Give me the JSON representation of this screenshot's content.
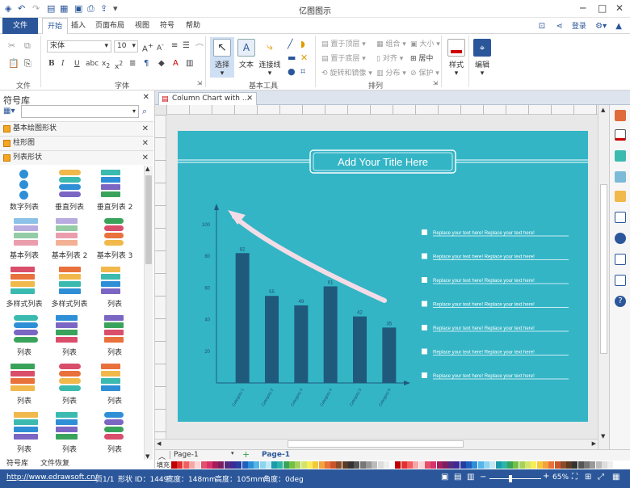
{
  "app": {
    "title": "亿图图示"
  },
  "menu": {
    "file": "文件",
    "tabs": [
      "开始",
      "插入",
      "页面布局",
      "视图",
      "符号",
      "帮助"
    ],
    "login": "登录"
  },
  "ribbon": {
    "groups": {
      "file": "文件",
      "font": "字体",
      "basic_tools": "基本工具",
      "arrange": "排列"
    },
    "font_name": "宋体",
    "font_size": "10",
    "tools": {
      "select": "选择",
      "text": "文本",
      "connector": "连接线"
    },
    "arrange": {
      "bring_front": "置于顶层",
      "send_back": "置于底层",
      "rotate_mirror": "旋转和镜像",
      "group": "组合",
      "align": "对齐",
      "distribute": "分布",
      "size": "大小",
      "center": "居中",
      "protect": "保护"
    },
    "style": "样式",
    "edit": "编辑"
  },
  "library": {
    "title": "符号库",
    "categories": [
      "基本绘图形状",
      "柱形图",
      "列表形状"
    ],
    "shapes": [
      {
        "label": "数字列表",
        "icon": "number-list-icon"
      },
      {
        "label": "垂直列表",
        "icon": "vertical-list-icon"
      },
      {
        "label": "垂直列表 2",
        "icon": "vertical-list-2-icon"
      },
      {
        "label": "基本列表",
        "icon": "basic-list-icon"
      },
      {
        "label": "基本列表 2",
        "icon": "basic-list-2-icon"
      },
      {
        "label": "基本列表 3",
        "icon": "basic-list-3-icon"
      },
      {
        "label": "多样式列表",
        "icon": "multi-style-list-icon"
      },
      {
        "label": "多样式列表",
        "icon": "multi-style-list-2-icon"
      },
      {
        "label": "列表",
        "icon": "list-icon"
      },
      {
        "label": "列表",
        "icon": "list-icon"
      },
      {
        "label": "列表",
        "icon": "list-icon"
      },
      {
        "label": "列表",
        "icon": "list-icon"
      },
      {
        "label": "列表",
        "icon": "list-icon"
      },
      {
        "label": "列表",
        "icon": "list-icon"
      },
      {
        "label": "列表",
        "icon": "list-icon"
      },
      {
        "label": "列表",
        "icon": "list-icon"
      },
      {
        "label": "列表",
        "icon": "list-icon"
      },
      {
        "label": "列表",
        "icon": "list-icon"
      }
    ],
    "bottom_tabs": [
      "符号库",
      "文件恢复"
    ]
  },
  "document": {
    "tab": "Column Chart with ...",
    "page_tab": "Page-1",
    "page_tab_active": "Page-1",
    "palette_label": "填充"
  },
  "colors": {
    "accent": "#2b579a",
    "page_bg": "#33b5c6",
    "bar": "#1f5a7c",
    "arrow": "#f3dce6"
  },
  "chart_data": {
    "type": "bar",
    "title": "Add Your Title Here",
    "categories": [
      "Category 1",
      "Category 2",
      "Category 3",
      "Category 4",
      "Category 5",
      "Category 6"
    ],
    "values": [
      82,
      55,
      49,
      61,
      42,
      35
    ],
    "ylim": [
      0,
      100
    ],
    "yticks": [
      20,
      40,
      60,
      80,
      100
    ],
    "legend_items": [
      "Replace your text here!   Replace your text here!",
      "Replace your text here!   Replace your text here!",
      "Replace your text here!   Replace your text here!",
      "Replace your text here!   Replace your text here!",
      "Replace your text here!   Replace your text here!",
      "Replace your text here!   Replace your text here!",
      "Replace your text here!   Replace your text here!"
    ]
  },
  "status": {
    "url": "http://www.edrawsoft.cn/",
    "page": "页1/1",
    "shape_id": "形状 ID：1449",
    "width": "宽度：148mm",
    "height": "高度：105mm",
    "angle": "角度：0deg",
    "zoom": "65%"
  }
}
